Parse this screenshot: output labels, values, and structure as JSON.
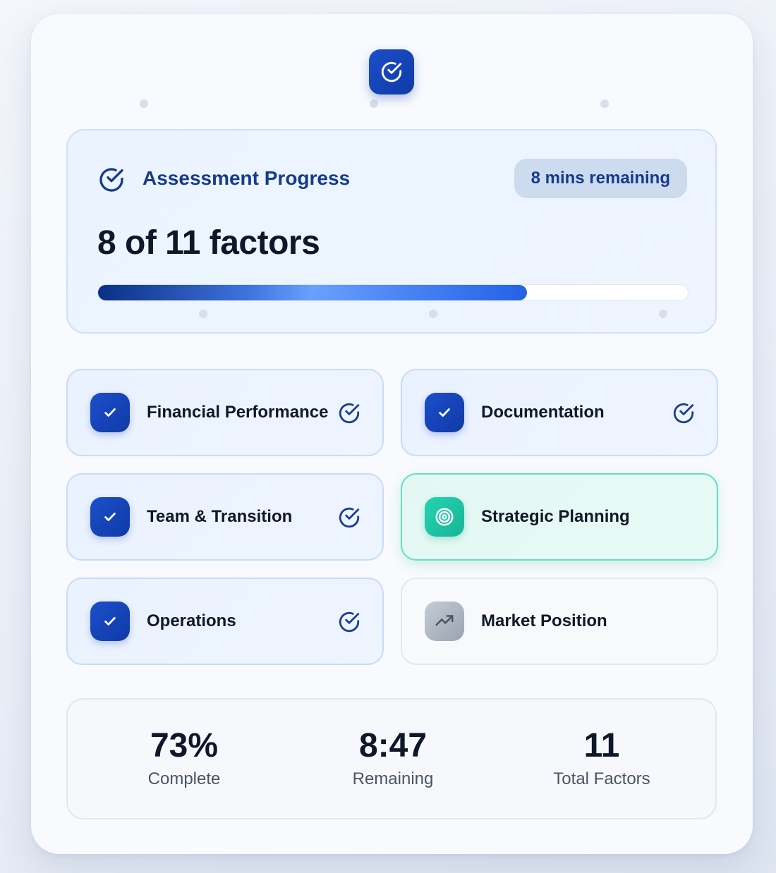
{
  "header": {
    "icon": "check-circle-icon"
  },
  "progress": {
    "icon": "check-circle-icon",
    "title": "Assessment Progress",
    "time_remaining": "8 mins remaining",
    "count_label": "8 of 11 factors",
    "fraction": 0.727
  },
  "factors": [
    {
      "label": "Financial Performance",
      "status": "complete",
      "icon": "checkmark-icon",
      "status_icon": "check-circle-icon"
    },
    {
      "label": "Documentation",
      "status": "complete",
      "icon": "checkmark-icon",
      "status_icon": "check-circle-icon"
    },
    {
      "label": "Team & Transition",
      "status": "complete",
      "icon": "checkmark-icon",
      "status_icon": "check-circle-icon"
    },
    {
      "label": "Strategic Planning",
      "status": "active",
      "icon": "target-icon"
    },
    {
      "label": "Operations",
      "status": "complete",
      "icon": "checkmark-icon",
      "status_icon": "check-circle-icon"
    },
    {
      "label": "Market Position",
      "status": "pending",
      "icon": "trending-up-icon"
    }
  ],
  "stats": [
    {
      "value": "73%",
      "label": "Complete"
    },
    {
      "value": "8:47",
      "label": "Remaining"
    },
    {
      "value": "11",
      "label": "Total Factors"
    }
  ],
  "colors": {
    "primary": "#1d4fc9",
    "active": "#26d3b0",
    "pending": "#a0a8b5"
  }
}
